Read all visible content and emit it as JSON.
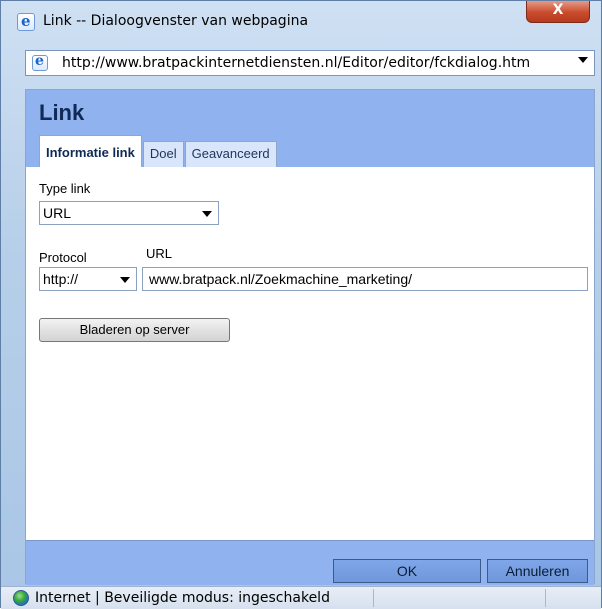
{
  "window": {
    "title": "Link -- Dialoogvenster van webpagina",
    "close_label": "X",
    "address_url": "http://www.bratpackinternetdiensten.nl/Editor/editor/fckdialog.htm"
  },
  "dialog": {
    "title": "Link",
    "tabs": [
      {
        "label": "Informatie link"
      },
      {
        "label": "Doel"
      },
      {
        "label": "Geavanceerd"
      }
    ],
    "type_link_label": "Type link",
    "type_link_value": "URL",
    "protocol_label": "Protocol",
    "protocol_value": "http://",
    "url_label": "URL",
    "url_value": "www.bratpack.nl/Zoekmachine_marketing/",
    "browse_button": "Bladeren op server",
    "ok_button": "OK",
    "cancel_button": "Annuleren"
  },
  "status": {
    "text": "Internet | Beveiligde modus: ingeschakeld"
  },
  "icons": {
    "title": "ie-icon",
    "address": "ie-icon",
    "status": "globe-icon"
  }
}
